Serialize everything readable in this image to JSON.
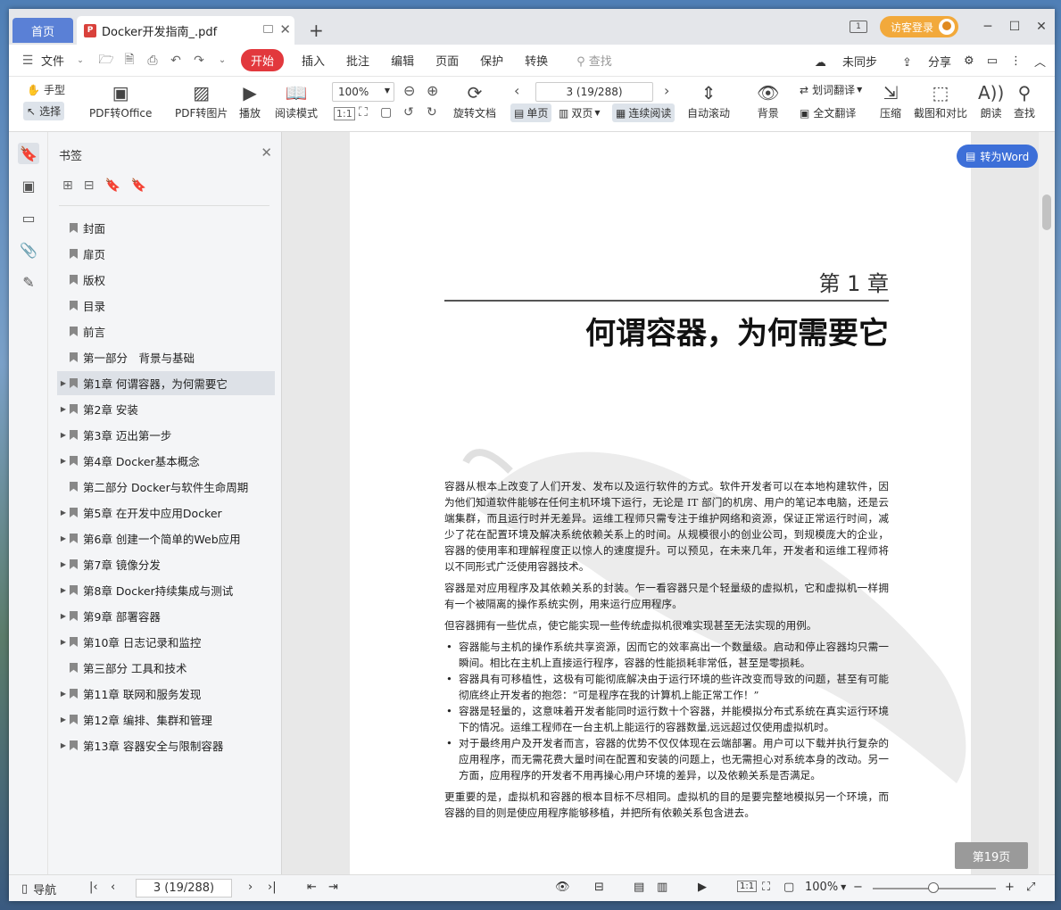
{
  "titlebar": {
    "home_tab": "首页",
    "doc_tab": "Docker开发指南_.pdf",
    "page_icon_label": "1",
    "login_label": "访客登录"
  },
  "menubar": {
    "file": "文件",
    "start": "开始",
    "items": [
      "插入",
      "批注",
      "编辑",
      "页面",
      "保护",
      "转换"
    ],
    "search_placeholder": "查找",
    "right": {
      "sync": "未同步",
      "share": "分享"
    }
  },
  "ribbon": {
    "hand": "手型",
    "select": "选择",
    "pdf_to_office": "PDF转Office",
    "pdf_to_image": "PDF转图片",
    "play": "播放",
    "read_mode": "阅读模式",
    "zoom": "100%",
    "rotate_doc": "旋转文档",
    "page_indicator": "3 (19/288)",
    "single_page": "单页",
    "double_page": "双页",
    "continuous": "连续阅读",
    "auto_scroll": "自动滚动",
    "background": "背景",
    "word_translate": "划词翻译",
    "full_translate": "全文翻译",
    "compress": "压缩",
    "crop_compare": "截图和对比",
    "read_aloud": "朗读",
    "find": "查找"
  },
  "bookmarks": {
    "header": "书签",
    "items": [
      {
        "label": "封面",
        "expandable": false
      },
      {
        "label": "扉页",
        "expandable": false
      },
      {
        "label": "版权",
        "expandable": false
      },
      {
        "label": "目录",
        "expandable": false
      },
      {
        "label": "前言",
        "expandable": false
      },
      {
        "label": "第一部分　背景与基础",
        "expandable": false
      },
      {
        "label": "第1章 何谓容器，为何需要它",
        "expandable": true,
        "selected": true
      },
      {
        "label": "第2章 安装",
        "expandable": true
      },
      {
        "label": "第3章 迈出第一步",
        "expandable": true
      },
      {
        "label": "第4章 Docker基本概念",
        "expandable": true
      },
      {
        "label": "第二部分 Docker与软件生命周期",
        "expandable": false
      },
      {
        "label": "第5章 在开发中应用Docker",
        "expandable": true
      },
      {
        "label": "第6章 创建一个简单的Web应用",
        "expandable": true
      },
      {
        "label": "第7章 镜像分发",
        "expandable": true
      },
      {
        "label": "第8章 Docker持续集成与测试",
        "expandable": true
      },
      {
        "label": "第9章 部署容器",
        "expandable": true
      },
      {
        "label": "第10章 日志记录和监控",
        "expandable": true
      },
      {
        "label": "第三部分 工具和技术",
        "expandable": false
      },
      {
        "label": "第11章 联网和服务发现",
        "expandable": true
      },
      {
        "label": "第12章 编排、集群和管理",
        "expandable": true
      },
      {
        "label": "第13章 容器安全与限制容器",
        "expandable": true
      }
    ]
  },
  "page": {
    "chapter_no": "第 1 章",
    "chapter_title": "何谓容器，为何需要它",
    "p1": "容器从根本上改变了人们开发、发布以及运行软件的方式。软件开发者可以在本地构建软件，因为他们知道软件能够在任何主机环境下运行，无论是 IT 部门的机房、用户的笔记本电脑，还是云端集群，而且运行时并无差异。运维工程师只需专注于维护网络和资源，保证正常运行时间，减少了花在配置环境及解决系统依赖关系上的时间。从规模很小的创业公司，到规模庞大的企业，容器的使用率和理解程度正以惊人的速度提升。可以预见，在未来几年，开发者和运维工程师将以不同形式广泛使用容器技术。",
    "p2": "容器是对应用程序及其依赖关系的封装。乍一看容器只是个轻量级的虚拟机，它和虚拟机一样拥有一个被隔离的操作系统实例，用来运行应用程序。",
    "p3": "但容器拥有一些优点，使它能实现一些传统虚拟机很难实现甚至无法实现的用例。",
    "bullets": [
      "容器能与主机的操作系统共享资源，因而它的效率高出一个数量级。启动和停止容器均只需一瞬间。相比在主机上直接运行程序，容器的性能损耗非常低，甚至是零损耗。",
      "容器具有可移植性，这极有可能彻底解决由于运行环境的些许改变而导致的问题，甚至有可能彻底终止开发者的抱怨：“可是程序在我的计算机上能正常工作！”",
      "容器是轻量的，这意味着开发者能同时运行数十个容器，并能模拟分布式系统在真实运行环境下的情况。运维工程师在一台主机上能运行的容器数量,远远超过仅使用虚拟机时。",
      "对于最终用户及开发者而言，容器的优势不仅仅体现在云端部署。用户可以下载并执行复杂的应用程序，而无需花费大量时间在配置和安装的问题上，也无需担心对系统本身的改动。另一方面，应用程序的开发者不用再操心用户环境的差异，以及依赖关系是否满足。"
    ],
    "p4": "更重要的是，虚拟机和容器的根本目标不尽相同。虚拟机的目的是要完整地模拟另一个环境，而容器的目的则是使应用程序能够移植，并把所有依赖关系包含进去。"
  },
  "to_word": "转为Word",
  "page_badge": "第19页",
  "statusbar": {
    "nav": "导航",
    "page": "3 (19/288)",
    "zoom": "100%"
  }
}
